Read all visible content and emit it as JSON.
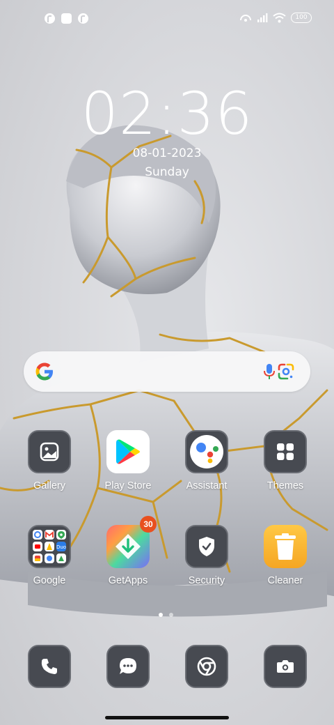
{
  "status_bar": {
    "battery": "100",
    "notifications": [
      "app-notification-icon",
      "square-notification-icon",
      "app-notification-icon"
    ],
    "indicators": [
      "hotspot-icon",
      "signal-icon",
      "wifi-icon"
    ]
  },
  "lockscreen": {
    "time": "02:36",
    "date": "08-01-2023",
    "day": "Sunday"
  },
  "search": {
    "icons": [
      "google-g-icon",
      "microphone-icon",
      "google-lens-icon"
    ]
  },
  "apps": [
    {
      "label": "Gallery",
      "icon": "gallery-icon"
    },
    {
      "label": "Play Store",
      "icon": "play-store-icon"
    },
    {
      "label": "Assistant",
      "icon": "assistant-icon"
    },
    {
      "label": "Themes",
      "icon": "themes-icon"
    },
    {
      "label": "Google",
      "icon": "google-folder-icon"
    },
    {
      "label": "GetApps",
      "icon": "getapps-icon",
      "badge": "30"
    },
    {
      "label": "Security",
      "icon": "shield-icon"
    },
    {
      "label": "Cleaner",
      "icon": "trash-icon"
    }
  ],
  "page_indicator": {
    "pages": 2,
    "active": 1
  },
  "dock": [
    {
      "icon": "phone-icon"
    },
    {
      "icon": "messages-icon"
    },
    {
      "icon": "chrome-icon"
    },
    {
      "icon": "camera-icon"
    }
  ],
  "colors": {
    "badge": "#e8501f",
    "icon_tile": "#474a51",
    "cleaner": "#f5b32f",
    "google_blue": "#4285F4",
    "google_red": "#EA4335",
    "google_yellow": "#FBBC05",
    "google_green": "#34A853"
  }
}
